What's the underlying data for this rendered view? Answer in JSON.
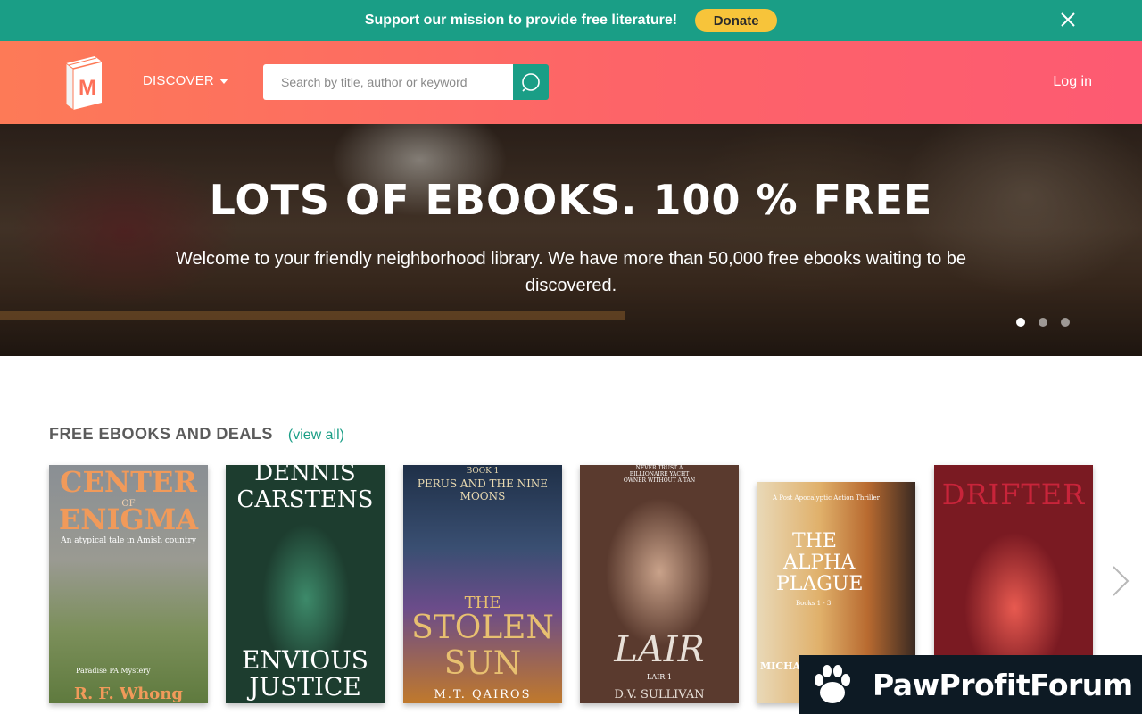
{
  "promo": {
    "message": "Support our mission to provide free literature!",
    "donate_label": "Donate",
    "close_icon": "close-icon"
  },
  "header": {
    "logo_letter": "M",
    "discover_label": "DISCOVER",
    "search_placeholder": "Search by title, author or keyword",
    "search_icon": "search-icon",
    "login_label": "Log in"
  },
  "hero": {
    "title": "LOTS OF EBOOKS. 100 % FREE",
    "subtitle": "Welcome to your friendly neighborhood library. We have more than 50,000 free ebooks waiting to be discovered.",
    "slides": 3,
    "active_slide": 1
  },
  "section": {
    "title": "FREE EBOOKS AND DEALS",
    "view_all": "(view all)"
  },
  "books": [
    {
      "title_line1": "CENTER",
      "title_of": "OF",
      "title_line2": "ENIGMA",
      "tagline": "An atypical tale in Amish country",
      "series": "Paradise PA Mystery",
      "author": "R. F. Whong"
    },
    {
      "author": "DENNIS CARSTENS",
      "title_line1": "ENVIOUS",
      "title_line2": "JUSTICE"
    },
    {
      "book_no": "BOOK 1",
      "series": "PERUS AND THE NINE MOONS",
      "title_line1": "THE",
      "title_line2": "STOLEN",
      "title_line3": "SUN",
      "author": "M.T. QAIROS"
    },
    {
      "tagline": "NEVER TRUST A BILLIONAIRE YACHT OWNER WITHOUT A TAN",
      "title": "LAIR",
      "series": "LAIR 1",
      "author": "D.V. SULLIVAN"
    },
    {
      "tagline": "A Post Apocalyptic Action Thriller",
      "title_line1": "THE",
      "title_line2": "ALPHA",
      "title_line3": "PLAGUE",
      "books": "Books 1 - 3",
      "spine": "THE ALPHA PLAGUE",
      "author": "MICHAEL"
    },
    {
      "title": "DRIFTER"
    }
  ],
  "badge": {
    "text": "PawProfitForum"
  },
  "colors": {
    "teal": "#1a9e86",
    "donate_yellow": "#f7c43a",
    "header_gradient_start": "#fd7a57",
    "header_gradient_end": "#fd5a72"
  }
}
